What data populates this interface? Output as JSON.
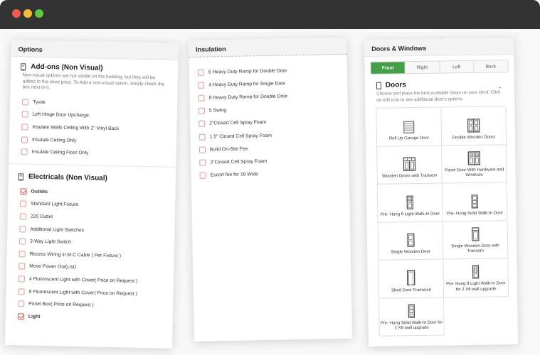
{
  "window": {
    "controls": [
      "close",
      "minimize",
      "maximize"
    ]
  },
  "options_panel": {
    "title": "Options",
    "addons": {
      "title": "Add-ons (Non Visual)",
      "description": "Non-visual options are not visible on the building, but they will be added to the shed price. To Add a non-visual option, simply check the box next to it.",
      "items": [
        {
          "label": "Tyvek",
          "checked": false
        },
        {
          "label": "Left Hinge Door Upcharge",
          "checked": false
        },
        {
          "label": "Insulate Walls Ceiling With 2\" Vinyl Back",
          "checked": false
        },
        {
          "label": "Insulate Ceiling Only",
          "checked": false
        },
        {
          "label": "Insulate Ceiling Floor Only",
          "checked": false
        }
      ]
    },
    "electricals": {
      "title": "Electricals (Non Visual)",
      "items": [
        {
          "label": "Outlets",
          "checked": true
        },
        {
          "label": "Standard Light Fixture",
          "checked": false
        },
        {
          "label": "220 Outlet",
          "checked": false
        },
        {
          "label": "Additional Light Switches",
          "checked": false
        },
        {
          "label": "3-Way Light Switch",
          "checked": false
        },
        {
          "label": "Recess Wiring in M.C Cable ( Per Fixture )",
          "checked": false
        },
        {
          "label": "Move Power Out(List)",
          "checked": false
        },
        {
          "label": "4 Fluorescent Light with Cover( Price on Request )",
          "checked": false
        },
        {
          "label": "8 Fluorescent Light with Cover( Price on Request )",
          "checked": false
        },
        {
          "label": "Panel Box( Price on Request )",
          "checked": false
        },
        {
          "label": "Light",
          "checked": true
        }
      ]
    }
  },
  "insulation_panel": {
    "title": "Insulation",
    "items": [
      {
        "label": "6 Heavy Duty Ramp for Double Door"
      },
      {
        "label": "4 Heavy Duty Ramp for Single Door"
      },
      {
        "label": "8 Heavy Duty Ramp for Double Door"
      },
      {
        "label": "5 Swing"
      },
      {
        "label": "2\"Closed Cell Spray Foam"
      },
      {
        "label": "1.5\" Closed Cell Spray Foam"
      },
      {
        "label": "Build On-Site Fee"
      },
      {
        "label": "3\"Closed Cell Spray Foam"
      },
      {
        "label": "Escort fee for 16 Wide"
      }
    ]
  },
  "doors_panel": {
    "title": "Doors & Windows",
    "tabs": [
      {
        "label": "Front",
        "active": true
      },
      {
        "label": "Right",
        "active": false
      },
      {
        "label": "Left",
        "active": false
      },
      {
        "label": "Back",
        "active": false
      }
    ],
    "section_title": "Doors",
    "description": "Choose and place the best available doors on your shed. Click on edit icon to see additional door's options.",
    "doors": [
      {
        "label": "Roll Up Garage Door",
        "icon": "roll-up-door-icon"
      },
      {
        "label": "Double Wooden Doors",
        "icon": "double-door-icon"
      },
      {
        "label": "Wooden Doors with Transom",
        "icon": "transom-door-icon"
      },
      {
        "label": "Panel Door With Hardware and Windows",
        "icon": "panel-door-icon"
      },
      {
        "label": "Pre- Hung 6 Light Walk-In Door",
        "icon": "walk-in-door-icon"
      },
      {
        "label": "Pre- Hung Solid Walk-In Door",
        "icon": "walk-in-door-icon"
      },
      {
        "label": "Single Wooden Door",
        "icon": "single-door-icon"
      },
      {
        "label": "Single Wooden Door with Transom",
        "icon": "single-door-transom-icon"
      },
      {
        "label": "Shed Door Frameout",
        "icon": "frameout-icon"
      },
      {
        "label": "Pre- Hung 9 Light Walk-In Door for 2 X6 wall upgrade",
        "icon": "walk-in-door-icon"
      },
      {
        "label": "Pre- Hung Solid Walk-In Door for 2 X6 wall upgrade",
        "icon": "walk-in-door-icon"
      }
    ]
  },
  "colors": {
    "accent_green": "#43a047",
    "checkbox_red": "#d9534f"
  }
}
